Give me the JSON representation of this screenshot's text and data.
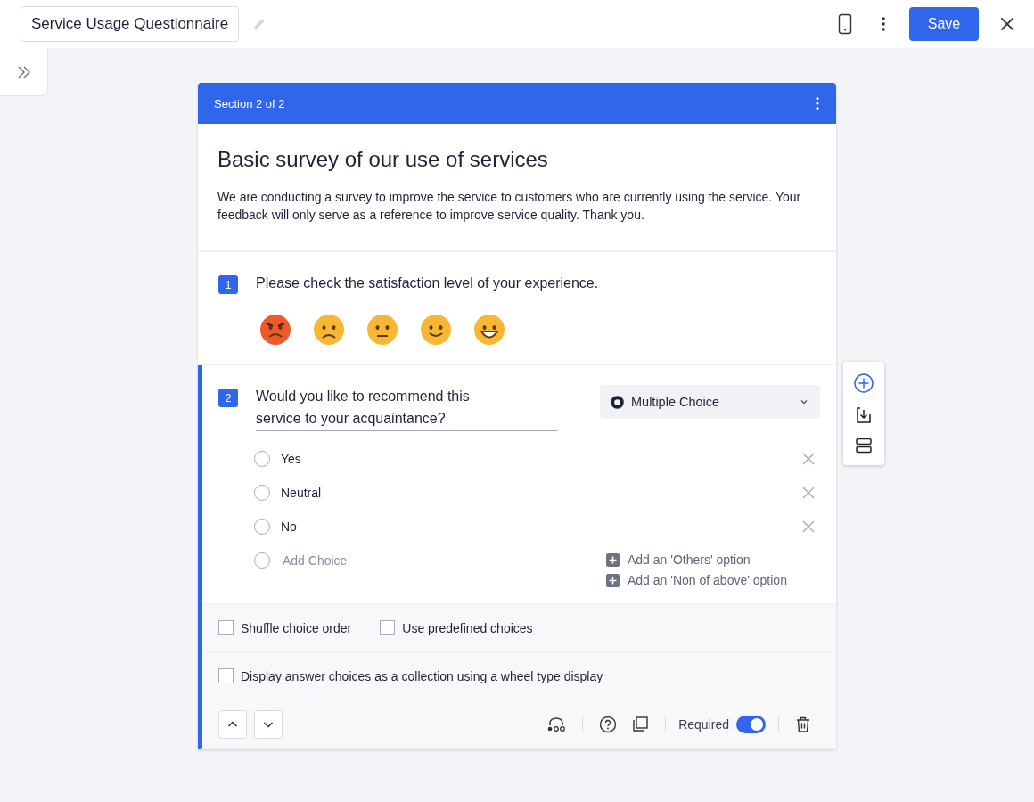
{
  "header": {
    "title": "Service Usage Questionnaire",
    "save_label": "Save"
  },
  "section": {
    "label": "Section 2 of 2",
    "title": "Basic survey of our use of services",
    "description": "We are conducting a survey to improve the service to customers who are currently using the service. Your feedback will only serve as a reference to improve service quality. Thank you."
  },
  "questions": [
    {
      "kind": "emoji",
      "number": "1",
      "text": "Please check the satisfaction level of your experience.",
      "active": false
    },
    {
      "kind": "choice",
      "number": "2",
      "text": "Would you like to recommend this service to your acquaintance?",
      "active": true,
      "type_select": "Multiple Choice",
      "choices": [
        "Yes",
        "Neutral",
        "No"
      ],
      "add_choice": {
        "placeholder": "Add Choice"
      },
      "extra_options": [
        "Add an 'Others' option",
        "Add an 'Non of above' option"
      ],
      "options": [
        {
          "label": "Shuffle choice order",
          "checked": false
        },
        {
          "label": "Use predefined choices",
          "checked": false
        }
      ],
      "options_2": [
        {
          "label": "Display answer choices as a collection using a wheel type display",
          "checked": false
        }
      ],
      "required": {
        "label": "Required",
        "on": true
      }
    }
  ]
}
